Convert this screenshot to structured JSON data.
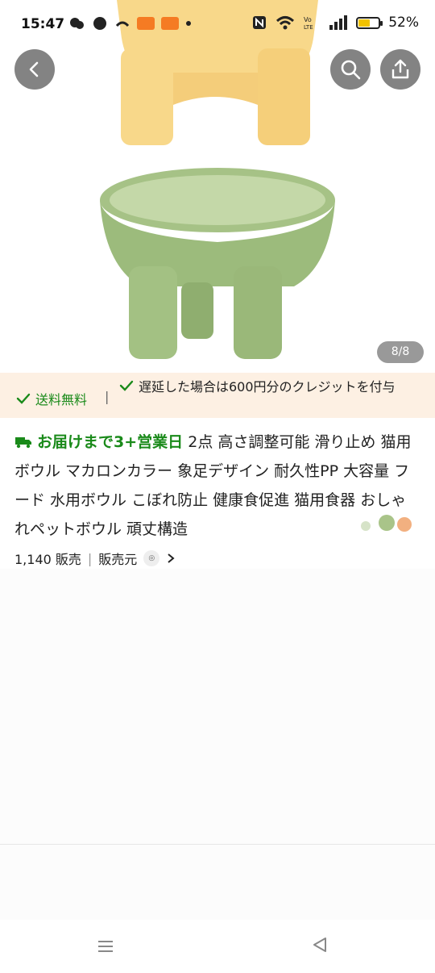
{
  "status": {
    "time": "15:47",
    "battery_percent": "52%",
    "battery_level": 0.52,
    "wifi_label": "Vo LTE"
  },
  "header": {
    "back_icon": "chevron-left-icon",
    "search_icon": "search-icon",
    "share_icon": "share-icon"
  },
  "gallery": {
    "counter": "8/8"
  },
  "shipping": {
    "free_label": "送料無料",
    "separator": "|",
    "credit_label": "遅延した場合は600円分のクレジットを付与"
  },
  "product": {
    "delivery_label": "お届けまで3+営業日",
    "title": "2点 高さ調整可能 滑り止め 猫用ボウル マカロンカラー 象足デザイン 耐久性PP 大容量 フード 水用ボウル こぼれ防止 健康食促進 猫用食器 おしゃれペットボウル 頑丈構造",
    "sales": "1,140 販売",
    "seller_label": "販売元",
    "divider": "|"
  },
  "colors": {
    "green": "#1a8a1a",
    "banner_bg": "#fdf0e3",
    "bowl_yellow": "#f9d98a",
    "bowl_green": "#a9c489"
  }
}
